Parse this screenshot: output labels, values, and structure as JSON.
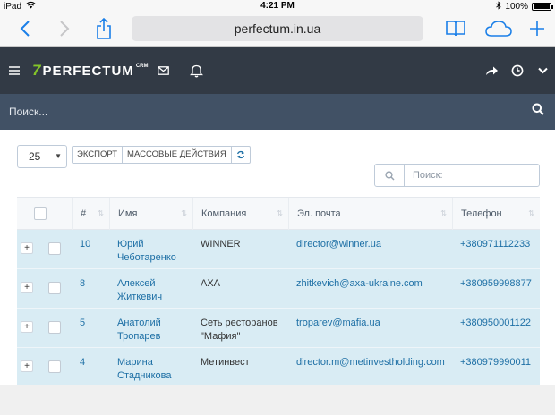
{
  "status": {
    "device": "iPad",
    "time": "4:21 PM",
    "battery": "100%"
  },
  "browser": {
    "url": "perfectum.in.ua"
  },
  "header": {
    "logo_mark": "7",
    "logo_text": "PERFECTUM",
    "logo_sup": "CRM"
  },
  "search": {
    "placeholder": "Поиск..."
  },
  "toolbar": {
    "page_length": "25",
    "export_label": "ЭКСПОРТ",
    "bulk_label": "МАССОВЫЕ ДЕЙСТВИЯ",
    "table_search_placeholder": "Поиск:"
  },
  "table": {
    "columns": [
      "#",
      "Имя",
      "Компания",
      "Эл. почта",
      "Телефон"
    ],
    "rows": [
      {
        "id": "10",
        "name1": "Юрий",
        "name2": "Чеботаренко",
        "company1": "WINNER",
        "company2": "",
        "email": "director@winner.ua",
        "phone": "+380971112233"
      },
      {
        "id": "8",
        "name1": "Алексей",
        "name2": "Житкевич",
        "company1": "AXA",
        "company2": "",
        "email": "zhitkevich@axa-ukraine.com",
        "phone": "+380959998877"
      },
      {
        "id": "5",
        "name1": "Анатолий",
        "name2": "Тропарев",
        "company1": "Сеть ресторанов",
        "company2": "\"Мафия\"",
        "email": "troparev@mafia.ua",
        "phone": "+380950001122"
      },
      {
        "id": "4",
        "name1": "Марина",
        "name2": "Стадникова",
        "company1": "Метинвест",
        "company2": "",
        "email": "director.m@metinvestholding.com",
        "phone": "+380979990011"
      }
    ]
  },
  "colors": {
    "header_bg": "#323a45",
    "search_bg": "#415165",
    "row_highlight": "#d9ecf4",
    "link": "#1d6fa5",
    "brand_green": "#84c529",
    "ios_blue": "#1a7fe8"
  }
}
